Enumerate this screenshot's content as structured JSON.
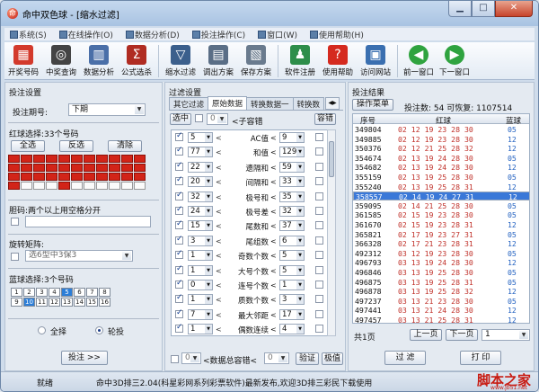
{
  "window": {
    "title": "命中双色球 - [缩水过滤]",
    "app_icon": "chinese-character-icon"
  },
  "menu": [
    "系统(S)",
    "在线操作(O)",
    "数据分析(D)",
    "投注操作(C)",
    "窗口(W)",
    "使用帮助(H)"
  ],
  "toolbar": [
    {
      "label": "开奖号码",
      "icon": "lottery-balls-icon",
      "color": "#d33a2c",
      "glyph": "▦"
    },
    {
      "label": "中奖查询",
      "icon": "binoculars-icon",
      "color": "#444444",
      "glyph": "◎"
    },
    {
      "label": "数据分析",
      "icon": "bar-chart-icon",
      "color": "#4a6fa8",
      "glyph": "▥"
    },
    {
      "label": "公式选杀",
      "icon": "sigma-icon",
      "color": "#b02c22",
      "glyph": "Σ"
    },
    {
      "label": "缩水过滤",
      "icon": "filter-funnel-icon",
      "color": "#3b5f8c",
      "glyph": "▽"
    },
    {
      "label": "调出方案",
      "icon": "open-document-icon",
      "color": "#5a6e86",
      "glyph": "▤"
    },
    {
      "label": "保存方案",
      "icon": "save-document-icon",
      "color": "#6a7b8e",
      "glyph": "▧"
    },
    {
      "label": "软件注册",
      "icon": "person-register-icon",
      "color": "#2e8e4a",
      "glyph": "♟"
    },
    {
      "label": "使用帮助",
      "icon": "help-question-icon",
      "color": "#d52a1f",
      "glyph": "?"
    },
    {
      "label": "访问网站",
      "icon": "network-computer-icon",
      "color": "#3a6fb0",
      "glyph": "▣"
    },
    {
      "label": "前一窗口",
      "icon": "arrow-left-icon",
      "color": "#2fa33f",
      "glyph": "◀"
    },
    {
      "label": "下一窗口",
      "icon": "arrow-right-icon",
      "color": "#2fa33f",
      "glyph": "▶"
    }
  ],
  "left": {
    "section_title": "投注设置",
    "period_label": "投注期号:",
    "period_value": "下期",
    "red_label": "红球选择:33个号码",
    "btn_all": "全选",
    "btn_invert": "反选",
    "btn_clear": "清除",
    "red_selected": [
      1,
      1,
      1,
      1,
      1,
      1,
      1,
      1,
      1,
      1,
      1,
      1,
      1,
      1,
      1,
      1,
      1,
      1,
      1,
      1,
      1,
      1,
      1,
      1,
      1,
      1,
      1,
      1,
      1,
      1,
      1,
      1,
      1,
      1,
      0,
      0,
      0,
      1,
      0,
      0,
      0,
      0,
      0,
      0
    ],
    "dan_label": "胆码:两个以上用空格分开",
    "rotate_label": "旋转矩阵:",
    "rotate_value": "选6型中3保3",
    "blue_label": "蓝球选择:3个号码",
    "blue_numbers": [
      "1",
      "2",
      "3",
      "4",
      "5",
      "6",
      "7",
      "8",
      "9",
      "10",
      "11",
      "12",
      "13",
      "14",
      "15",
      "16"
    ],
    "blue_selected": [
      0,
      0,
      0,
      0,
      1,
      0,
      0,
      0,
      0,
      1,
      0,
      0,
      0,
      0,
      0,
      0
    ],
    "radio_full": "全择",
    "radio_wheel": "轮投",
    "btn_bet": "投注 >>"
  },
  "middle": {
    "section_title": "过滤设置",
    "tabs": [
      "其它过滤",
      "原始数据",
      "转换数据一",
      "转换数"
    ],
    "active_tab": 1,
    "select_all": "选中",
    "error_label": "<子容错",
    "error_value": "0",
    "btn_tolerance": "容错",
    "rows": [
      {
        "min": "5",
        "name": "AC值",
        "max": "9"
      },
      {
        "min": "77",
        "name": "和值",
        "max": "129"
      },
      {
        "min": "22",
        "name": "遗隔和",
        "max": "59"
      },
      {
        "min": "20",
        "name": "间隔和",
        "max": "33"
      },
      {
        "min": "32",
        "name": "极号和",
        "max": "35"
      },
      {
        "min": "24",
        "name": "极号差",
        "max": "32"
      },
      {
        "min": "15",
        "name": "尾数和",
        "max": "37"
      },
      {
        "min": "3",
        "name": "尾组数",
        "max": "6"
      },
      {
        "min": "1",
        "name": "奇数个数",
        "max": "5"
      },
      {
        "min": "1",
        "name": "大号个数",
        "max": "5"
      },
      {
        "min": "0",
        "name": "连号个数",
        "max": "1"
      },
      {
        "min": "1",
        "name": "质数个数",
        "max": "3"
      },
      {
        "min": "7",
        "name": "最大邻距",
        "max": "17"
      },
      {
        "min": "1",
        "name": "偶数连续",
        "max": "4"
      }
    ],
    "bottom_min": "0",
    "bottom_label": "<数据总容错<",
    "bottom_max": "0",
    "btn_verify": "验证",
    "btn_extreme": "极值"
  },
  "right": {
    "section_title": "投注结果",
    "btn_menu": "操作菜单",
    "summary": "投注数: 54 可恢复: 1107514",
    "col_seq": "序号",
    "col_red": "红球",
    "col_blue": "蓝球",
    "rows": [
      {
        "q": "349804",
        "r": "02 12 19 23 28 30",
        "b": "05"
      },
      {
        "q": "349885",
        "r": "02 12 19 23 28 30",
        "b": "12"
      },
      {
        "q": "350376",
        "r": "02 12 21 25 28 32",
        "b": "12"
      },
      {
        "q": "354674",
        "r": "02 13 19 24 28 30",
        "b": "05"
      },
      {
        "q": "354682",
        "r": "02 13 19 24 28 30",
        "b": "12"
      },
      {
        "q": "355159",
        "r": "02 13 19 25 28 30",
        "b": "05"
      },
      {
        "q": "355240",
        "r": "02 13 19 25 28 31",
        "b": "12"
      },
      {
        "q": "358557",
        "r": "02 14 19 24 27 31",
        "b": "12"
      },
      {
        "q": "359095",
        "r": "02 14 21 25 28 30",
        "b": "05"
      },
      {
        "q": "361585",
        "r": "02 15 19 23 28 30",
        "b": "05"
      },
      {
        "q": "361670",
        "r": "02 15 19 23 28 31",
        "b": "12"
      },
      {
        "q": "365821",
        "r": "02 17 19 23 27 31",
        "b": "05"
      },
      {
        "q": "366328",
        "r": "02 17 21 23 28 31",
        "b": "12"
      },
      {
        "q": "492312",
        "r": "03 12 19 23 28 30",
        "b": "05"
      },
      {
        "q": "496793",
        "r": "03 13 19 24 28 30",
        "b": "12"
      },
      {
        "q": "496846",
        "r": "03 13 19 25 28 30",
        "b": "05"
      },
      {
        "q": "496875",
        "r": "03 13 19 25 28 31",
        "b": "05"
      },
      {
        "q": "496878",
        "r": "03 13 19 25 28 32",
        "b": "12"
      },
      {
        "q": "497237",
        "r": "03 13 21 23 28 30",
        "b": "05"
      },
      {
        "q": "497441",
        "r": "03 13 21 24 28 30",
        "b": "12"
      },
      {
        "q": "497457",
        "r": "03 13 21 25 28 31",
        "b": "12"
      }
    ],
    "selected_row": 7,
    "page_label": "共1页",
    "btn_prev": "上一页",
    "btn_next": "下一页",
    "page_value": "1",
    "btn_filter": "过 滤",
    "btn_print": "打 印"
  },
  "status": {
    "state": "就绪",
    "message": "命中3D排三2.04(科星彩网系列彩票软件)最新发布,欢迎3D排三彩民下载使用",
    "watermark": "脚本之家",
    "watermark_sub": "www.jb51.net"
  }
}
